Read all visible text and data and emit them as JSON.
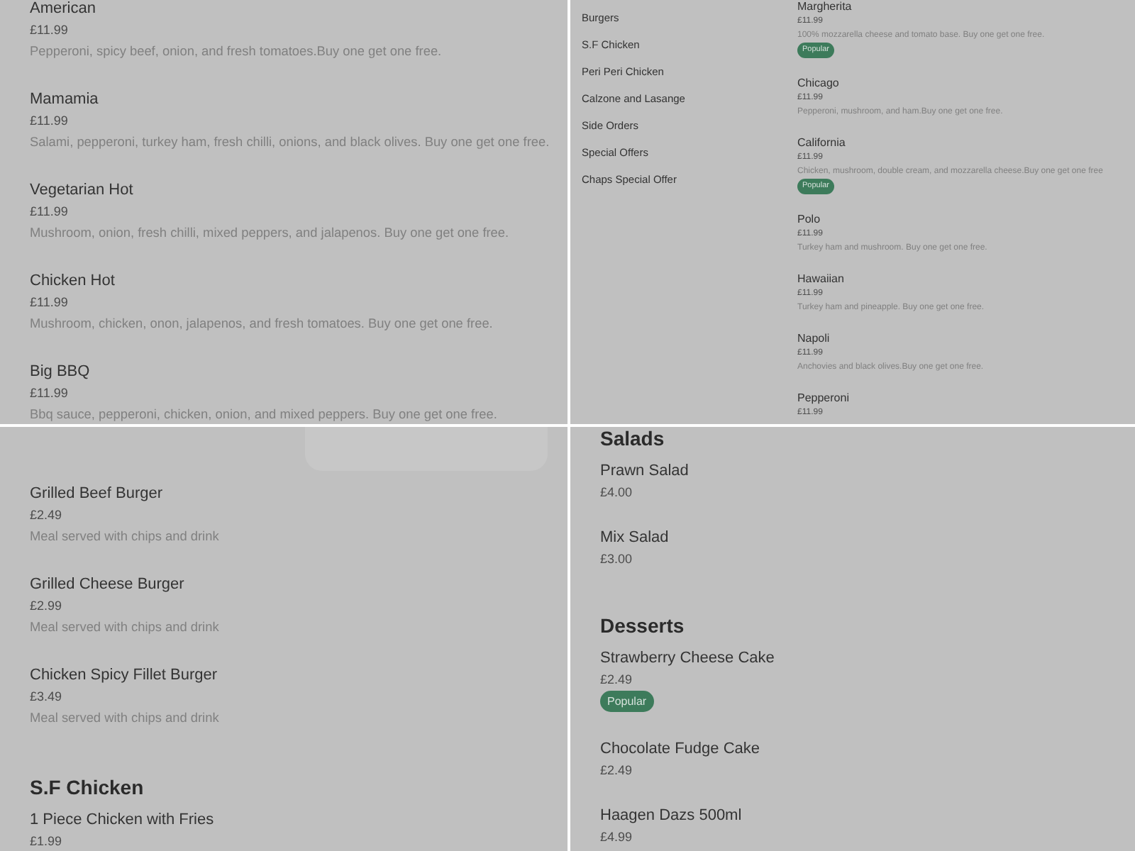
{
  "panels": [
    {
      "kind": "menu",
      "sections": [
        {
          "items": [
            {
              "name": "American",
              "price": "£11.99",
              "description": "Pepperoni, spicy beef, onion, and fresh tomatoes.Buy one get one free."
            },
            {
              "name": "Mamamia",
              "price": "£11.99",
              "description": "Salami, pepperoni, turkey ham, fresh chilli, onions, and black olives. Buy one get one free."
            },
            {
              "name": "Vegetarian Hot",
              "price": "£11.99",
              "description": "Mushroom, onion, fresh chilli, mixed peppers, and jalapenos. Buy one get one free."
            },
            {
              "name": "Chicken Hot",
              "price": "£11.99",
              "description": "Mushroom, chicken, onon, jalapenos, and fresh tomatoes. Buy one get one free."
            },
            {
              "name": "Big BBQ",
              "price": "£11.99",
              "description": "Bbq sauce, pepperoni, chicken, onion, and mixed peppers. Buy one get one free."
            }
          ]
        }
      ]
    },
    {
      "kind": "menu_with_sidebar",
      "sidebar": {
        "items": [
          "Burgers",
          "S.F Chicken",
          "Peri Peri Chicken",
          "Calzone and Lasange",
          "Side Orders",
          "Special Offers",
          "Chaps Special Offer"
        ]
      },
      "sections": [
        {
          "items": [
            {
              "name": "Margherita",
              "price": "£11.99",
              "description": "100% mozzarella cheese and tomato base. Buy one get one free.",
              "badge": "Popular"
            },
            {
              "name": "Chicago",
              "price": "£11.99",
              "description": "Pepperoni, mushroom, and ham.Buy one get one free."
            },
            {
              "name": "California",
              "price": "£11.99",
              "description": "Chicken, mushroom, double cream, and mozzarella cheese.Buy one get one free",
              "badge": "Popular"
            },
            {
              "name": "Polo",
              "price": "£11.99",
              "description": "Turkey ham and mushroom. Buy one get one free."
            },
            {
              "name": "Hawaiian",
              "price": "£11.99",
              "description": "Turkey ham and pineapple. Buy one get one free."
            },
            {
              "name": "Napoli",
              "price": "£11.99",
              "description": "Anchovies and black olives.Buy one get one free."
            },
            {
              "name": "Pepperoni",
              "price": "£11.99"
            }
          ]
        }
      ]
    },
    {
      "kind": "menu",
      "card": true,
      "sections": [
        {
          "items": [
            {
              "name": "Grilled Beef Burger",
              "price": "£2.49",
              "description": "Meal served with chips and drink"
            },
            {
              "name": "Grilled Cheese Burger",
              "price": "£2.99",
              "description": "Meal served with chips and drink"
            },
            {
              "name": "Chicken Spicy Fillet Burger",
              "price": "£3.49",
              "description": "Meal served with chips and drink"
            }
          ]
        },
        {
          "heading": "S.F Chicken",
          "items": [
            {
              "name": "1 Piece Chicken with Fries",
              "price": "£1.99"
            }
          ]
        }
      ]
    },
    {
      "kind": "menu",
      "sections": [
        {
          "heading": "Salads",
          "items": [
            {
              "name": "Prawn Salad",
              "price": "£4.00"
            },
            {
              "name": "Mix Salad",
              "price": "£3.00"
            }
          ]
        },
        {
          "heading": "Desserts",
          "items": [
            {
              "name": "Strawberry Cheese Cake",
              "price": "£2.49",
              "badge": "Popular"
            },
            {
              "name": "Chocolate Fudge Cake",
              "price": "£2.49"
            },
            {
              "name": "Haagen Dazs 500ml",
              "price": "£4.99"
            }
          ]
        }
      ]
    }
  ]
}
